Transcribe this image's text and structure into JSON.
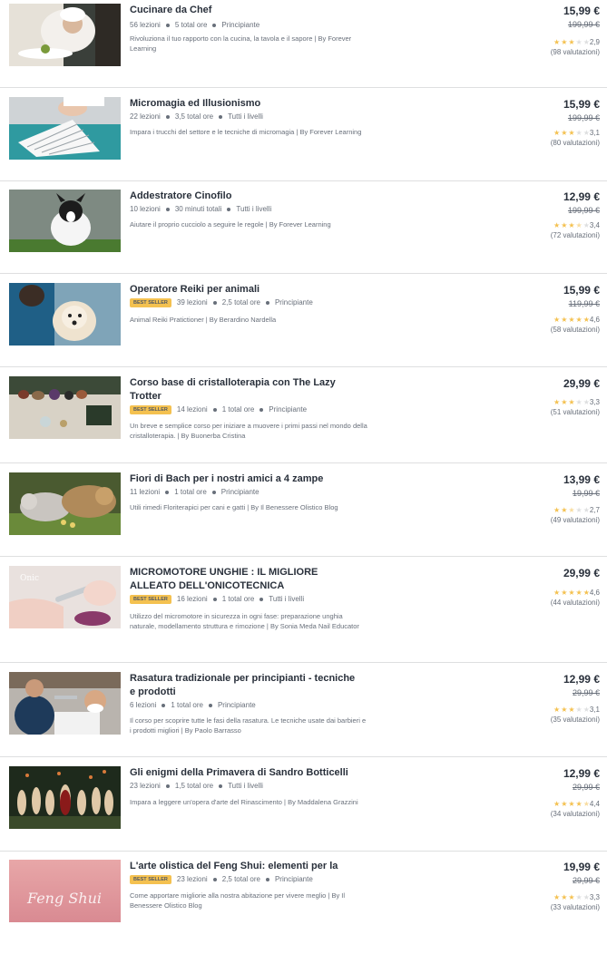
{
  "colors": {
    "star": "#f4c150",
    "badge": "#f4c150",
    "text": "#29303b",
    "muted": "#686f7a"
  },
  "courses": [
    {
      "title": "Cucinare da Chef",
      "bestseller": false,
      "lectures": "56 lezioni",
      "hours": "5 total ore",
      "level": "Principiante",
      "desc": "Rivoluziona il tuo rapporto con la cucina, la tavola e il sapore | By Forever Learning",
      "price": "15,99 €",
      "old_price": "199,99 €",
      "rating": "2,9",
      "stars": 3,
      "reviews": "(98 valutazioni)"
    },
    {
      "title": "Micromagia ed Illusionismo",
      "bestseller": false,
      "lectures": "22 lezioni",
      "hours": "3,5 total ore",
      "level": "Tutti i livelli",
      "desc": "Impara i trucchi del settore e le tecniche di micromagia | By Forever Learning",
      "price": "15,99 €",
      "old_price": "199,99 €",
      "rating": "3,1",
      "stars": 3,
      "reviews": "(80 valutazioni)"
    },
    {
      "title": "Addestratore Cinofilo",
      "bestseller": false,
      "lectures": "10 lezioni",
      "hours": "30 minuti totali",
      "level": "Tutti i livelli",
      "desc": "Aiutare il proprio cucciolo a seguire le regole | By Forever Learning",
      "price": "12,99 €",
      "old_price": "199,99 €",
      "rating": "3,4",
      "stars": 3.5,
      "reviews": "(72 valutazioni)"
    },
    {
      "title": "Operatore Reiki per animali",
      "bestseller": true,
      "badge": "BEST SELLER",
      "lectures": "39 lezioni",
      "hours": "2,5 total ore",
      "level": "Principiante",
      "desc": "Animal Reiki Pratictioner | By Berardino Nardella",
      "price": "15,99 €",
      "old_price": "119,99 €",
      "rating": "4,6",
      "stars": 5,
      "reviews": "(58 valutazioni)"
    },
    {
      "title": "Corso base di cristalloterapia con The Lazy Trotter",
      "bestseller": true,
      "badge": "BEST SELLER",
      "lectures": "14 lezioni",
      "hours": "1 total ore",
      "level": "Principiante",
      "desc": "Un breve e semplice corso per iniziare a muovere i primi passi nel mondo della cristalloterapia. | By Buonerba Cristina",
      "price": "29,99 €",
      "old_price": "",
      "rating": "3,3",
      "stars": 3,
      "reviews": "(51 valutazioni)"
    },
    {
      "title": "Fiori di Bach per i nostri amici a 4 zampe",
      "bestseller": false,
      "lectures": "11 lezioni",
      "hours": "1 total ore",
      "level": "Principiante",
      "desc": "Utili rimedi Floriterapici per cani e gatti | By Il Benessere Olistico Blog",
      "price": "13,99 €",
      "old_price": "19,99 €",
      "rating": "2,7",
      "stars": 2.5,
      "reviews": "(49 valutazioni)"
    },
    {
      "title": "MICROMOTORE UNGHIE : IL MIGLIORE ALLEATO DELL'ONICOTECNICA",
      "bestseller": true,
      "badge": "BEST SELLER",
      "lectures": "16 lezioni",
      "hours": "1 total ore",
      "level": "Tutti i livelli",
      "desc": "Utilizzo del micromotore in sicurezza in ogni fase: preparazione unghia naturale, modellamento struttura e rimozione | By Sonia Meda Nail Educator",
      "price": "29,99 €",
      "old_price": "",
      "rating": "4,6",
      "stars": 5,
      "reviews": "(44 valutazioni)"
    },
    {
      "title": "Rasatura tradizionale per principianti - tecniche e prodotti",
      "bestseller": false,
      "lectures": "6 lezioni",
      "hours": "1 total ore",
      "level": "Principiante",
      "desc": "Il corso per scoprire tutte le fasi della rasatura. Le tecniche usate dai barbieri e i prodotti migliori | By Paolo Barrasso",
      "price": "12,99 €",
      "old_price": "29,99 €",
      "rating": "3,1",
      "stars": 3,
      "reviews": "(35 valutazioni)"
    },
    {
      "title": "Gli enigmi della Primavera di Sandro Botticelli",
      "bestseller": false,
      "lectures": "23 lezioni",
      "hours": "1,5 total ore",
      "level": "Tutti i livelli",
      "desc": "Impara a leggere un'opera d'arte del Rinascimento | By Maddalena Grazzini",
      "price": "12,99 €",
      "old_price": "29,99 €",
      "rating": "4,4",
      "stars": 4.5,
      "reviews": "(34 valutazioni)"
    },
    {
      "title": "L'arte olistica del Feng Shui: elementi per la casa",
      "bestseller": true,
      "badge": "BEST SELLER",
      "lectures": "23 lezioni",
      "hours": "2,5 total ore",
      "level": "Principiante",
      "desc": "Come apportare migliorie alla nostra abitazione per vivere meglio | By Il Benessere Olistico Blog",
      "price": "19,99 €",
      "old_price": "29,99 €",
      "rating": "3,3",
      "stars": 3,
      "reviews": "(33 valutazioni)",
      "thumb_text": "Feng Shui"
    }
  ]
}
